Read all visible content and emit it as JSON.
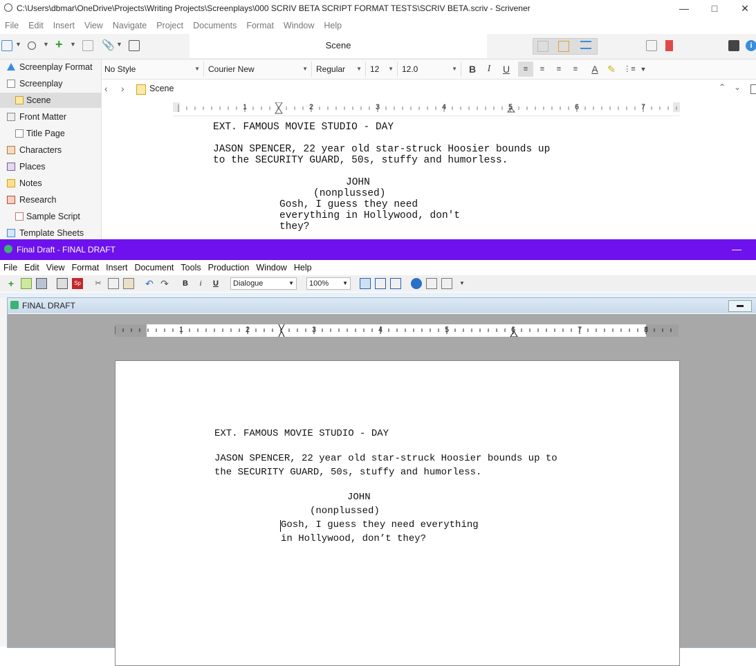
{
  "scrivener": {
    "title": "C:\\Users\\dbmar\\OneDrive\\Projects\\Writing Projects\\Screenplays\\000     SCRIV BETA SCRIPT FORMAT TESTS\\SCRIV BETA.scriv - Scrivener",
    "menu": [
      "File",
      "Edit",
      "Insert",
      "View",
      "Navigate",
      "Project",
      "Documents",
      "Format",
      "Window",
      "Help"
    ],
    "editor_tab": "Scene",
    "binder": [
      {
        "label": "Screenplay Format",
        "icon": "warning-icon",
        "indent": 0
      },
      {
        "label": "Screenplay",
        "icon": "document-icon",
        "indent": 0
      },
      {
        "label": "Scene",
        "icon": "scene-card-icon",
        "indent": 1,
        "selected": true
      },
      {
        "label": "Front Matter",
        "icon": "document-stack-icon",
        "indent": 0
      },
      {
        "label": "Title Page",
        "icon": "document-icon",
        "indent": 1
      },
      {
        "label": "Characters",
        "icon": "characters-icon",
        "indent": 0
      },
      {
        "label": "Places",
        "icon": "places-icon",
        "indent": 0
      },
      {
        "label": "Notes",
        "icon": "notes-icon",
        "indent": 0
      },
      {
        "label": "Research",
        "icon": "research-icon",
        "indent": 0
      },
      {
        "label": "Sample Script",
        "icon": "script-icon",
        "indent": 1
      },
      {
        "label": "Template Sheets",
        "icon": "template-icon",
        "indent": 0
      }
    ],
    "format_bar": {
      "style": "No Style",
      "font": "Courier New",
      "weight": "Regular",
      "size": "12",
      "line_spacing": "12.0"
    },
    "breadcrumb": "Scene",
    "ruler_numbers": [
      "1",
      "2",
      "3",
      "4",
      "5",
      "6",
      "7"
    ],
    "script": {
      "slug": "EXT. FAMOUS MOVIE STUDIO - DAY",
      "action1": "JASON SPENCER, 22 year old star-struck Hoosier bounds up",
      "action2": "to the SECURITY GUARD, 50s, stuffy and humorless.",
      "character": "JOHN",
      "parenthetical": "(nonplussed)",
      "dialogue1": "Gosh, I guess they need",
      "dialogue2": "everything in Hollywood, don't",
      "dialogue3": "they?"
    }
  },
  "finaldraft": {
    "title": "Final Draft - FINAL DRAFT",
    "menu": [
      "File",
      "Edit",
      "View",
      "Format",
      "Insert",
      "Document",
      "Tools",
      "Production",
      "Window",
      "Help"
    ],
    "element_style": "Dialogue",
    "zoom": "100%",
    "doc_title": "FINAL DRAFT",
    "ruler_numbers": [
      "1",
      "2",
      "3",
      "4",
      "5",
      "6",
      "7",
      "8"
    ],
    "script": {
      "slug": "EXT. FAMOUS MOVIE STUDIO - DAY",
      "action1": "JASON SPENCER, 22 year old star-struck Hoosier bounds up to",
      "action2": "the SECURITY GUARD, 50s, stuffy and humorless.",
      "character": "JOHN",
      "parenthetical": "(nonplussed)",
      "dialogue1": "Gosh, I guess they need everything",
      "dialogue2": "in Hollywood, don’t they?"
    }
  },
  "colors": {
    "fd_titlebar": "#6e12ed",
    "scriv_accent": "#3a8ddb"
  }
}
